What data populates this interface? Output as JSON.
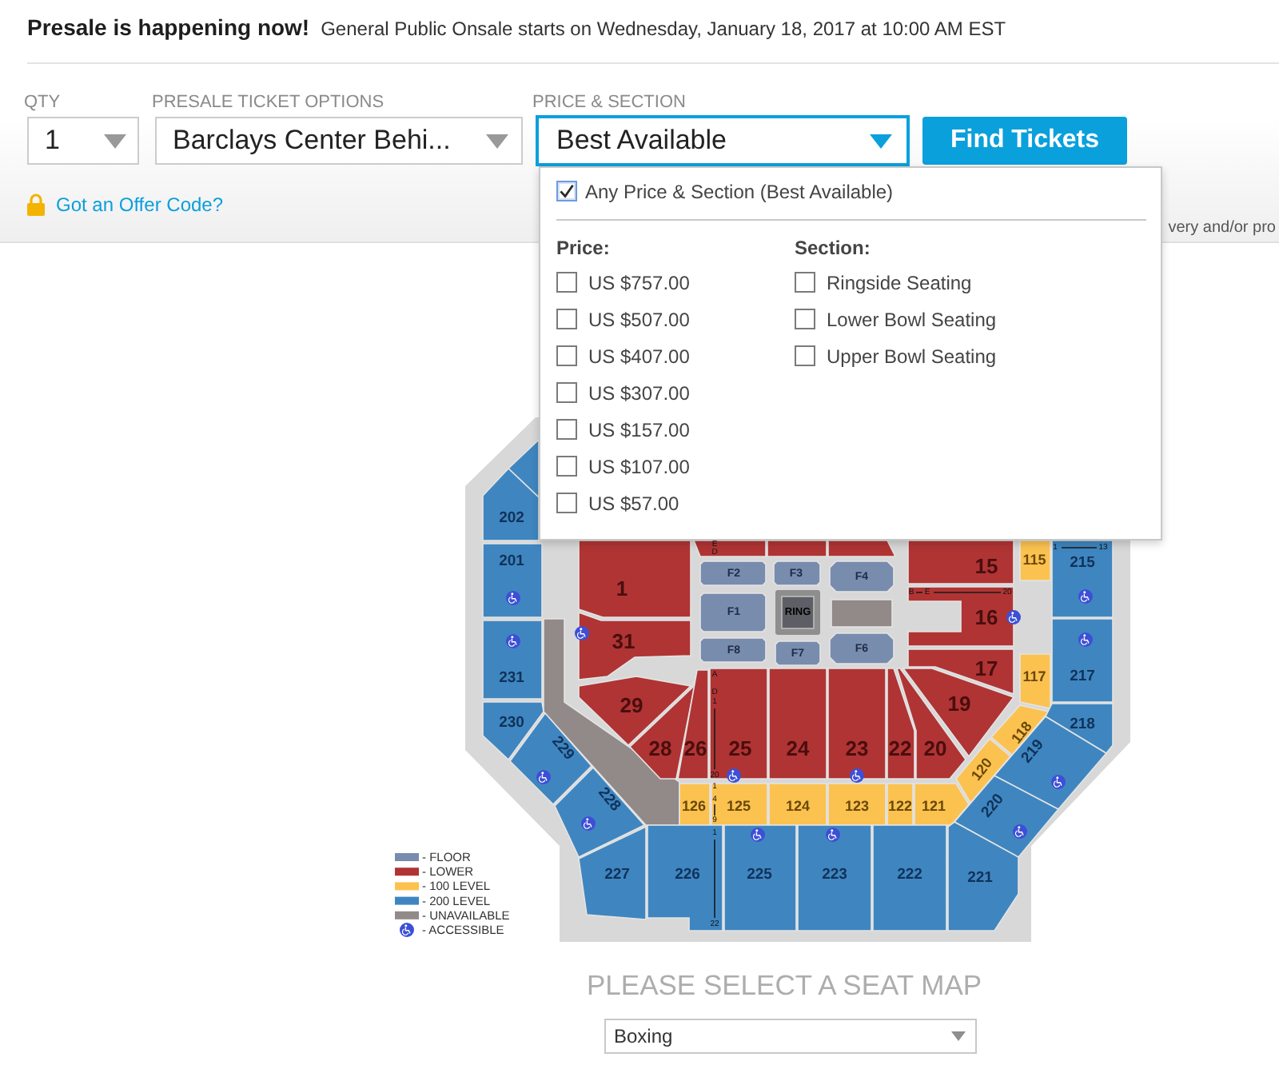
{
  "banner": {
    "headline": "Presale is happening now!",
    "detail": "General Public Onsale starts on Wednesday, January 18, 2017 at 10:00 AM EST"
  },
  "filters": {
    "qty": {
      "label": "QTY",
      "value": "1"
    },
    "ticket_options": {
      "label": "PRESALE TICKET OPTIONS",
      "value": "Barclays Center Behi..."
    },
    "price_section": {
      "label": "PRICE & SECTION",
      "value": "Best Available",
      "expanded": true
    },
    "find_button": "Find Tickets",
    "offer_link": "Got an Offer Code?",
    "note": "very and/or pro"
  },
  "dropdown": {
    "any": {
      "label": "Any Price & Section (Best Available)",
      "checked": true
    },
    "price_heading": "Price:",
    "prices": [
      {
        "label": "US $757.00",
        "checked": false
      },
      {
        "label": "US $507.00",
        "checked": false
      },
      {
        "label": "US $407.00",
        "checked": false
      },
      {
        "label": "US $307.00",
        "checked": false
      },
      {
        "label": "US $157.00",
        "checked": false
      },
      {
        "label": "US $107.00",
        "checked": false
      },
      {
        "label": "US $57.00",
        "checked": false
      }
    ],
    "section_heading": "Section:",
    "sections": [
      {
        "label": "Ringside Seating",
        "checked": false
      },
      {
        "label": "Lower Bowl Seating",
        "checked": false
      },
      {
        "label": "Upper Bowl Seating",
        "checked": false
      }
    ]
  },
  "seat_map": {
    "sections": [
      {
        "kind": "level200"
      },
      {
        "label": "202",
        "kind": "level200"
      },
      {
        "label": "201",
        "kind": "level200"
      },
      {
        "label": "1",
        "kind": "lower"
      },
      {
        "kind": "lower"
      },
      {
        "kind": "lower"
      },
      {
        "kind": "lower"
      },
      {
        "label": "15",
        "kind": "lower"
      },
      {
        "label": "115",
        "kind": "level100"
      },
      {
        "label": "215",
        "kind": "level200"
      },
      {
        "label": "F2",
        "kind": "floor"
      },
      {
        "label": "F3",
        "kind": "floor"
      },
      {
        "label": "F4",
        "kind": "floor"
      },
      {
        "label": "F1",
        "kind": "floor"
      },
      {
        "label": "RING",
        "kind": "ring"
      },
      {
        "kind": "unavailable"
      },
      {
        "label": "16",
        "kind": "lower"
      },
      {
        "label": "231",
        "kind": "level200"
      },
      {
        "kind": "unavailable"
      },
      {
        "label": "31",
        "kind": "lower"
      },
      {
        "label": "F8",
        "kind": "floor"
      },
      {
        "label": "F7",
        "kind": "floor"
      },
      {
        "label": "F6",
        "kind": "floor"
      },
      {
        "label": "17",
        "kind": "lower"
      },
      {
        "label": "117",
        "kind": "level100"
      },
      {
        "label": "217",
        "kind": "level200"
      },
      {
        "label": "230",
        "kind": "level200"
      },
      {
        "label": "229",
        "kind": "level200"
      },
      {
        "label": "29",
        "kind": "lower"
      },
      {
        "label": "28",
        "kind": "lower"
      },
      {
        "label": "26",
        "kind": "lower"
      },
      {
        "label": "25",
        "kind": "lower"
      },
      {
        "label": "24",
        "kind": "lower"
      },
      {
        "label": "23",
        "kind": "lower"
      },
      {
        "label": "22",
        "kind": "lower"
      },
      {
        "label": "20",
        "kind": "lower"
      },
      {
        "label": "19",
        "kind": "lower"
      },
      {
        "label": "228",
        "kind": "level200"
      },
      {
        "label": "120",
        "kind": "level100"
      },
      {
        "label": "118",
        "kind": "level100"
      },
      {
        "label": "220",
        "kind": "level200"
      },
      {
        "label": "219",
        "kind": "level200"
      },
      {
        "label": "218",
        "kind": "level200"
      },
      {
        "label": "126",
        "kind": "level100"
      },
      {
        "label": "125",
        "kind": "level100"
      },
      {
        "label": "124",
        "kind": "level100"
      },
      {
        "label": "123",
        "kind": "level100"
      },
      {
        "label": "122",
        "kind": "level100"
      },
      {
        "label": "121",
        "kind": "level100"
      },
      {
        "label": "227",
        "kind": "level200"
      },
      {
        "label": "226",
        "kind": "level200"
      },
      {
        "label": "225",
        "kind": "level200"
      },
      {
        "label": "223",
        "kind": "level200"
      },
      {
        "label": "222",
        "kind": "level200"
      },
      {
        "label": "221",
        "kind": "level200"
      }
    ],
    "row_markers": [
      "E",
      "D",
      "1",
      "13",
      "B",
      "E",
      "20",
      "A",
      "D",
      "1",
      "20",
      "1",
      "4",
      "9",
      "1",
      "22"
    ],
    "legend": [
      {
        "label": "- FLOOR",
        "kind": "floor"
      },
      {
        "label": "- LOWER",
        "kind": "lower"
      },
      {
        "label": "- 100 LEVEL",
        "kind": "level100"
      },
      {
        "label": "- 200 LEVEL",
        "kind": "level200"
      },
      {
        "label": "- UNAVAILABLE",
        "kind": "unavailable"
      },
      {
        "label": "- ACCESSIBLE",
        "kind": "accessible"
      }
    ]
  },
  "map_picker": {
    "title": "PLEASE SELECT A SEAT MAP",
    "value": "Boxing"
  }
}
